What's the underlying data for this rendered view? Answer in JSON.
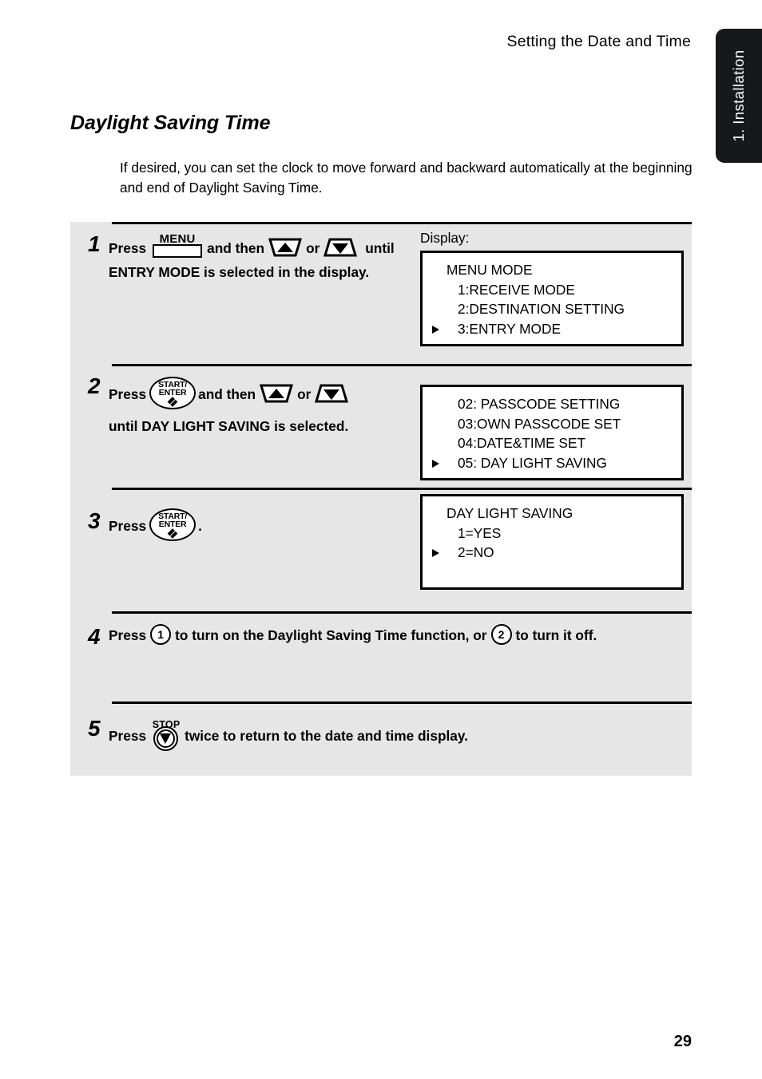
{
  "header": {
    "running_head": "Setting the Date and Time",
    "side_tab": "1. Installation"
  },
  "section": {
    "title": "Daylight Saving Time",
    "intro": "If desired, you can set the clock to move forward and backward automatically at the beginning and end of Daylight Saving Time."
  },
  "display_label": "Display:",
  "keys": {
    "menu": "MENU",
    "start_line1": "START/",
    "start_line2": "ENTER",
    "stop": "STOP",
    "num_one": "1",
    "num_two": "2"
  },
  "steps": [
    {
      "number": "1",
      "text_a": "Press",
      "text_b": "and then",
      "text_c": "or",
      "text_d": "until ENTRY MODE is selected in the display.",
      "display": {
        "label": "Display:",
        "lines": [
          {
            "text": "MENU MODE",
            "indent": 0,
            "marked": false
          },
          {
            "text": "1:RECEIVE MODE",
            "indent": 1,
            "marked": false
          },
          {
            "text": "2:DESTINATION SETTING",
            "indent": 1,
            "marked": false
          },
          {
            "text": "3:ENTRY MODE",
            "indent": 1,
            "marked": true
          }
        ]
      }
    },
    {
      "number": "2",
      "text_a": "Press",
      "text_b": "and then",
      "text_c": "or",
      "text_d": "until DAY LIGHT SAVING is selected.",
      "display": {
        "label": "",
        "lines": [
          {
            "text": "02: PASSCODE SETTING",
            "indent": 1,
            "marked": false
          },
          {
            "text": "03:OWN PASSCODE SET",
            "indent": 1,
            "marked": false
          },
          {
            "text": "04:DATE&TIME SET",
            "indent": 1,
            "marked": false
          },
          {
            "text": "05: DAY LIGHT SAVING",
            "indent": 1,
            "marked": true
          }
        ]
      }
    },
    {
      "number": "3",
      "text_a": "Press",
      "text_b": ".",
      "display": {
        "label": "",
        "lines": [
          {
            "text": "DAY LIGHT SAVING",
            "indent": 0,
            "marked": false
          },
          {
            "text": "1=YES",
            "indent": 1,
            "marked": false
          },
          {
            "text": "2=NO",
            "indent": 1,
            "marked": true
          }
        ]
      }
    },
    {
      "number": "4",
      "text_a": "Press",
      "text_b": "to turn on the Daylight Saving Time function, or",
      "text_c": "to turn it off."
    },
    {
      "number": "5",
      "text_a": "Press",
      "text_b": "twice to return to the date and time display."
    }
  ],
  "footer": {
    "page_number": "29"
  }
}
